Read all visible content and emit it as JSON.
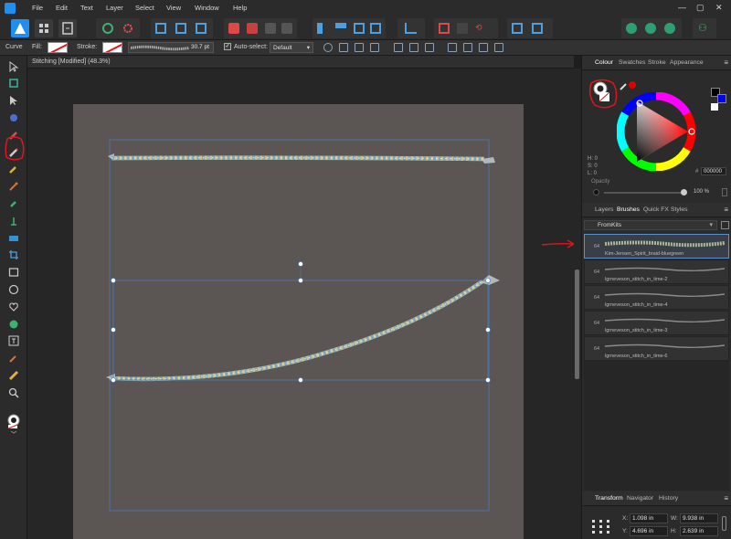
{
  "menubar": {
    "items": [
      "File",
      "Edit",
      "Text",
      "Layer",
      "Select",
      "View",
      "Window",
      "Help"
    ],
    "window_controls": [
      "—",
      "▢",
      "✕"
    ]
  },
  "context_toolbar": {
    "tool_label": "Curve",
    "fill_label": "Fill:",
    "stroke_label": "Stroke:",
    "stroke_width": "30.7 pt",
    "auto_select_label": "Auto-select:",
    "auto_select_value": "Default",
    "auto_select_checked": true
  },
  "document": {
    "title": "Stitching [Modified] (48.3%)"
  },
  "colour_panel": {
    "tabs": [
      "Colour",
      "Swatches",
      "Stroke",
      "Appearance"
    ],
    "active_tab": "Colour",
    "hsl_readout": [
      "H: 0",
      "S: 0",
      "L: 0"
    ],
    "hex_value": "000000",
    "opacity_label": "Opacity",
    "opacity_value": "100 %"
  },
  "brushes_panel": {
    "tabs": [
      "Layers",
      "Brushes",
      "Quick FX",
      "Styles"
    ],
    "active_tab": "Brushes",
    "category": "FromKits",
    "brushes": [
      {
        "size": "64",
        "name": "Kim-Jensen_Spirit_braid-bluegreen",
        "selected": true
      },
      {
        "size": "64",
        "name": "lgrneveson_stitch_in_time-2",
        "selected": false
      },
      {
        "size": "64",
        "name": "lgrneveson_stitch_in_time-4",
        "selected": false
      },
      {
        "size": "64",
        "name": "lgrneveson_stitch_in_time-3",
        "selected": false
      },
      {
        "size": "64",
        "name": "lgrneveson_stitch_in_time-6",
        "selected": false
      }
    ]
  },
  "transform_panel": {
    "tabs": [
      "Transform",
      "Navigator",
      "History"
    ],
    "active_tab": "Transform",
    "x_label": "X:",
    "x_value": "1.098 in",
    "y_label": "Y:",
    "y_value": "4.696 in",
    "w_label": "W:",
    "w_value": "9.938 in",
    "h_label": "H:",
    "h_value": "2.639 in"
  },
  "colors": {
    "accent": "#1f8ef1",
    "artboard": "#5b5654",
    "annotation": "#e0141e",
    "selection": "#4a7ab8"
  }
}
